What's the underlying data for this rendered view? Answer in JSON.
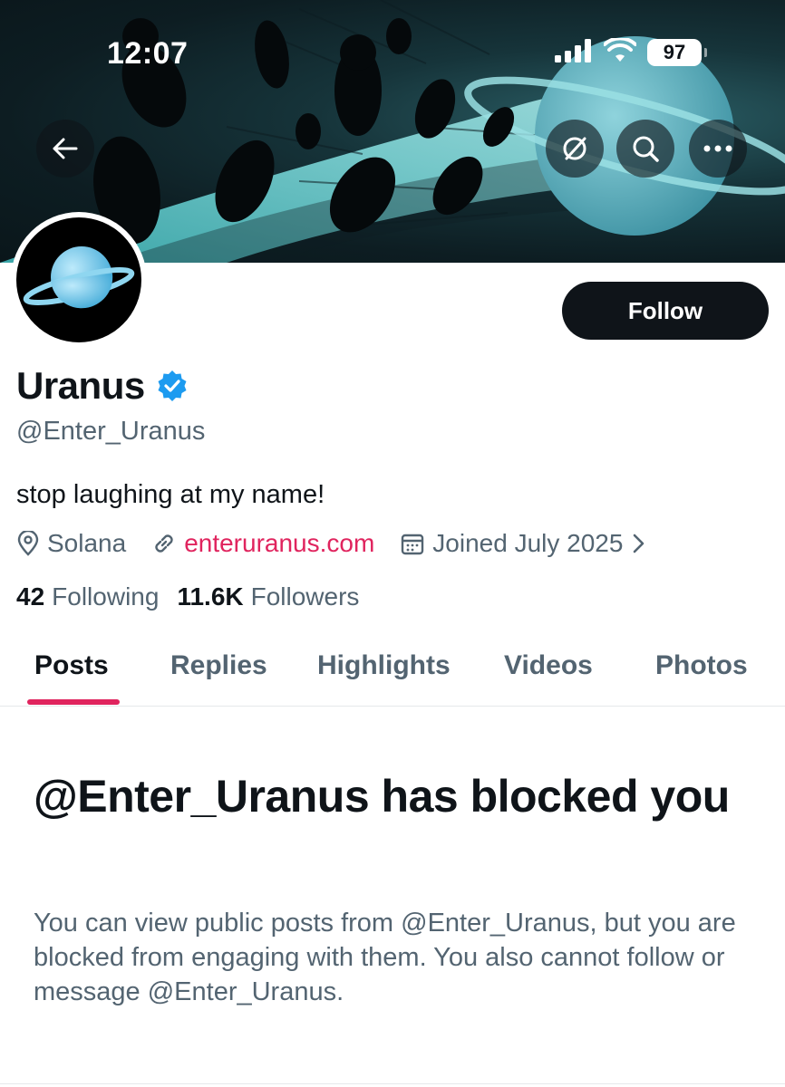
{
  "status_bar": {
    "time": "12:07",
    "battery_level": "97",
    "icons": [
      "cellular-signal-icon",
      "wifi-icon",
      "battery-icon"
    ]
  },
  "banner": {
    "description_icons": [
      "back-arrow-icon",
      "noise-icon",
      "search-icon",
      "more-icon"
    ]
  },
  "profile": {
    "display_name": "Uranus",
    "verified": true,
    "handle": "@Enter_Uranus",
    "bio": "stop laughing at my name!",
    "location": "Solana",
    "website": "enteruranus.com",
    "joined": "Joined July 2025",
    "follow_label": "Follow"
  },
  "stats": {
    "following_count": "42",
    "following_label": "Following",
    "followers_count": "11.6K",
    "followers_label": "Followers"
  },
  "tabs": [
    {
      "label": "Posts",
      "active": true
    },
    {
      "label": "Replies",
      "active": false
    },
    {
      "label": "Highlights",
      "active": false
    },
    {
      "label": "Videos",
      "active": false
    },
    {
      "label": "Photos",
      "active": false
    }
  ],
  "blocked": {
    "title": "@Enter_Uranus has blocked you",
    "body": "You can view public posts from @Enter_Uranus, but you are blocked from engaging with them. You also cannot follow or message @Enter_Uranus."
  },
  "colors": {
    "accent": "#e0245e",
    "text_primary": "#0f1419",
    "text_secondary": "#536471",
    "verified_badge": "#1d9bf0"
  }
}
